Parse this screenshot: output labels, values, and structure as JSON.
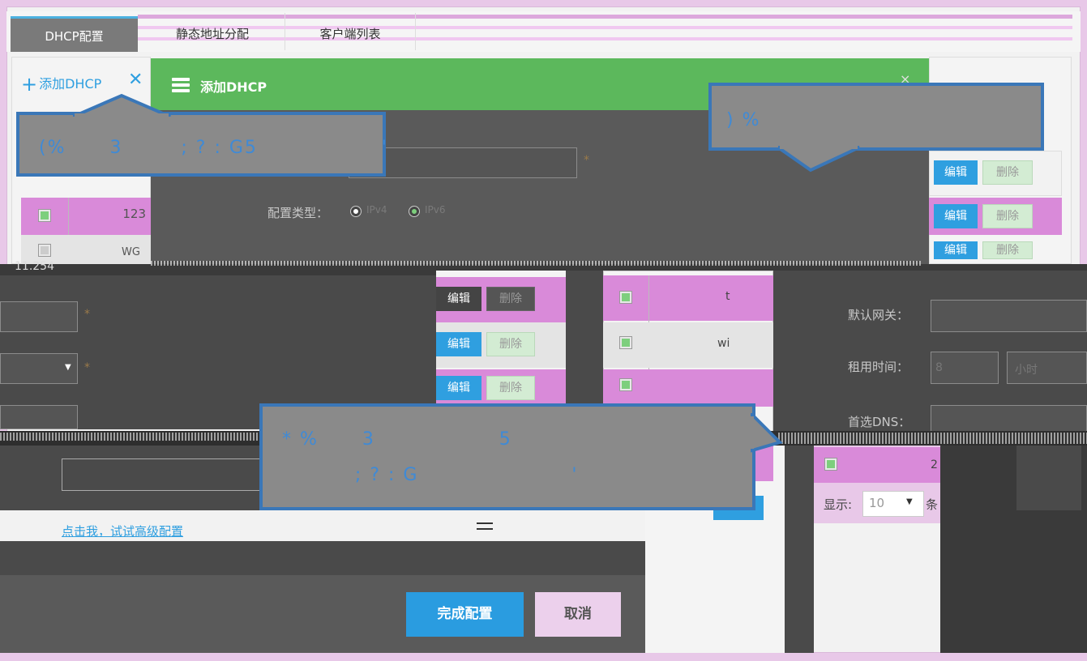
{
  "tabs": [
    "DHCP配置",
    "静态地址分配",
    "客户端列表"
  ],
  "toolbar": {
    "add_label": "添加DHCP",
    "plus": "+",
    "close": "✕"
  },
  "modal": {
    "title": "添加DHCP",
    "close": "×",
    "config_type_label": "配置类型：",
    "radio_1": "IPv4",
    "radio_2": "IPv6",
    "star": "*",
    "ip_fragment": "11.254",
    "advanced_link": "点击我，试试高级配置",
    "done_label": "完成配置",
    "cancel_label": "取消"
  },
  "left_table": {
    "rows": [
      {
        "value": "123"
      },
      {
        "value": "WG"
      }
    ]
  },
  "mid_table": {
    "rows": [
      {
        "edit": "编辑",
        "delete": "删除"
      },
      {
        "edit": "编辑",
        "delete": "删除"
      },
      {
        "edit": "编辑",
        "delete": "删除"
      }
    ]
  },
  "mid_table2": {
    "rows": [
      {
        "value": "t"
      },
      {
        "value": "wi"
      },
      {
        "value": ""
      }
    ]
  },
  "right_table": {
    "rows": [
      {
        "edit": "编辑",
        "delete": "删除"
      },
      {
        "edit": "编辑",
        "delete": "删除"
      },
      {
        "edit": "编辑",
        "delete": "删除"
      }
    ]
  },
  "right_form": {
    "gateway_label": "默认网关：",
    "lease_label": "租用时间：",
    "lease_value": "8",
    "lease_unit": "小时",
    "dns_label": "首选DNS：",
    "page_row_value": "2",
    "show_label": "显示:",
    "page_size": "10",
    "page_suffix": "条"
  },
  "callouts": {
    "one": "(%      3        ; ? : G5                 '",
    "two": ") %",
    "three_line1": "* %      3                 5",
    "three_line2": "          ; ? : G                     '"
  },
  "colors": {
    "accent_blue": "#2f9fe0",
    "green_header": "#5cb85c",
    "pink_row": "#d98ad9",
    "callout_border": "#3a77b8"
  }
}
